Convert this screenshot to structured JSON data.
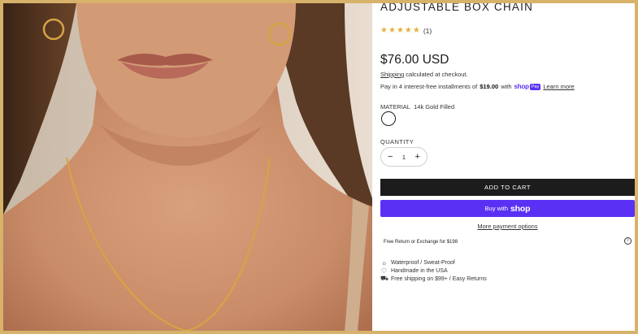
{
  "product": {
    "title": "ADJUSTABLE BOX CHAIN",
    "rating_count": "(1)",
    "price": "$76.00 USD"
  },
  "shipping": {
    "link": "Shipping",
    "text": " calculated at checkout."
  },
  "installments": {
    "prefix": "Pay in 4 interest-free installments of ",
    "amount": "$19.00",
    "with": " with ",
    "shop_word": "shop",
    "pay_badge": "Pay",
    "learn_more": "Learn more"
  },
  "options": {
    "material_label": "MATERIAL",
    "material_value": "14k Gold Filled",
    "quantity_label": "QUANTITY",
    "quantity_value": "1",
    "minus": "−",
    "plus": "+"
  },
  "actions": {
    "add_to_cart": "ADD TO CART",
    "buy_with": "Buy with",
    "buy_brand": "shop",
    "more_payment": "More payment options"
  },
  "notice": {
    "free_return": "Free Return or Exchange for $198",
    "info_glyph": "i"
  },
  "features": [
    {
      "icon": "sun-icon",
      "glyph": "☼",
      "text": "Waterproof / Sweat-Proof"
    },
    {
      "icon": "heart-icon",
      "glyph": "♡",
      "text": "Handmade in the USA"
    },
    {
      "icon": "truck-icon",
      "glyph": "⛟",
      "text": "Free shipping on $99+ / Easy Returns"
    }
  ],
  "colors": {
    "frame_border": "#d7b26a",
    "shop_pay_purple": "#5a31f4",
    "add_to_cart_bg": "#1c1c1c",
    "star": "#e3b23c"
  }
}
